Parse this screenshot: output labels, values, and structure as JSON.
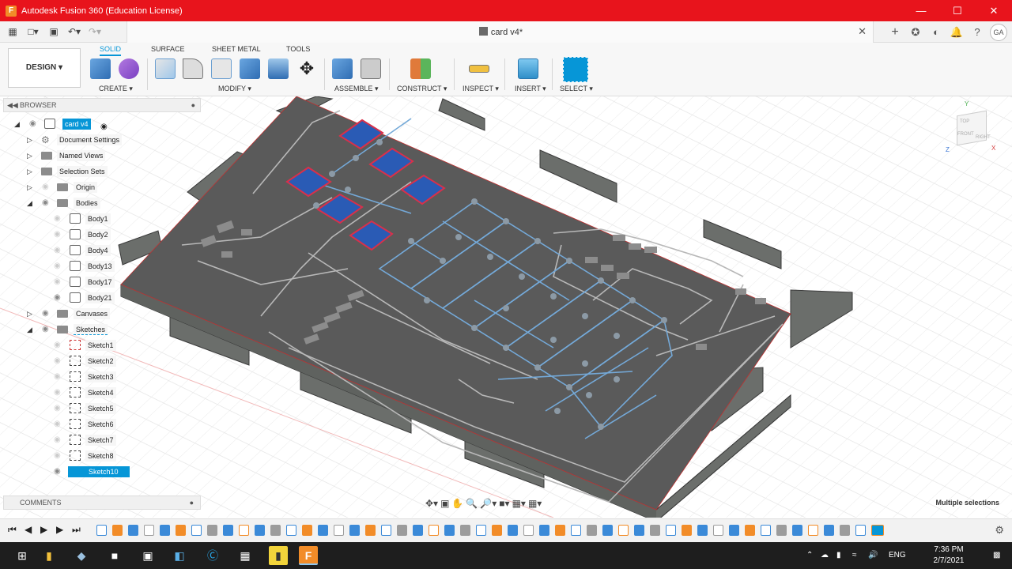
{
  "window": {
    "title": "Autodesk Fusion 360 (Education License)",
    "controls": [
      "minimize-icon",
      "maximize-icon",
      "close-icon"
    ]
  },
  "tabbar": {
    "document_title": "card v4*",
    "left_icons": [
      "grid-icon",
      "file-icon",
      "save-icon",
      "undo-icon",
      "redo-icon"
    ],
    "right_icons": [
      "add-icon",
      "extensions-icon",
      "job-status-icon",
      "notifications-icon",
      "help-icon"
    ],
    "user_initials": "GA"
  },
  "toolbar": {
    "workspace": "DESIGN ▾",
    "tabs": [
      "SOLID",
      "SURFACE",
      "SHEET METAL",
      "TOOLS"
    ],
    "active_tab": "SOLID",
    "groups": [
      {
        "label": "CREATE ▾"
      },
      {
        "label": "MODIFY ▾"
      },
      {
        "label": "ASSEMBLE ▾"
      },
      {
        "label": "CONSTRUCT ▾"
      },
      {
        "label": "INSPECT ▾"
      },
      {
        "label": "INSERT ▾"
      },
      {
        "label": "SELECT ▾"
      }
    ]
  },
  "browser": {
    "title": "BROWSER",
    "root": "card v4",
    "items": [
      {
        "label": "Document Settings",
        "type": "settings"
      },
      {
        "label": "Named Views",
        "type": "folder"
      },
      {
        "label": "Selection Sets",
        "type": "folder"
      },
      {
        "label": "Origin",
        "type": "folder"
      },
      {
        "label": "Bodies",
        "type": "folder",
        "expanded": true
      },
      {
        "label": "Body1",
        "type": "body"
      },
      {
        "label": "Body2",
        "type": "body"
      },
      {
        "label": "Body4",
        "type": "body"
      },
      {
        "label": "Body13",
        "type": "body"
      },
      {
        "label": "Body17",
        "type": "body"
      },
      {
        "label": "Body21",
        "type": "body"
      },
      {
        "label": "Canvases",
        "type": "folder"
      },
      {
        "label": "Sketches",
        "type": "folder",
        "expanded": true
      },
      {
        "label": "Sketch1",
        "type": "sketch"
      },
      {
        "label": "Sketch2",
        "type": "sketch"
      },
      {
        "label": "Sketch3",
        "type": "sketch"
      },
      {
        "label": "Sketch4",
        "type": "sketch"
      },
      {
        "label": "Sketch5",
        "type": "sketch"
      },
      {
        "label": "Sketch6",
        "type": "sketch"
      },
      {
        "label": "Sketch7",
        "type": "sketch"
      },
      {
        "label": "Sketch8",
        "type": "sketch"
      },
      {
        "label": "Sketch10",
        "type": "sketch",
        "selected": true
      }
    ]
  },
  "comments": {
    "title": "COMMENTS"
  },
  "status": {
    "selection": "Multiple selections"
  },
  "viewcube": {
    "top": "TOP",
    "front": "FRONT",
    "right": "RIGHT"
  },
  "taskbar": {
    "apps": [
      "start-icon",
      "file-explorer-icon",
      "app-icon",
      "terminal-icon",
      "network-icon",
      "remote-icon",
      "skype-icon",
      "app2-icon",
      "sticky-notes-icon",
      "fusion-icon"
    ],
    "language": "ENG",
    "time": "7:36 PM",
    "date": "2/7/2021"
  },
  "colors": {
    "titlebar": "#e8141c",
    "accent": "#0696d7",
    "model_top": "#5a5a5a",
    "model_side": "#6b6e6b",
    "trace": "#b8b8b8",
    "sketch": "#74a9d8",
    "pad_fill": "#2a5bb5",
    "pad_outline": "#d9304a"
  }
}
